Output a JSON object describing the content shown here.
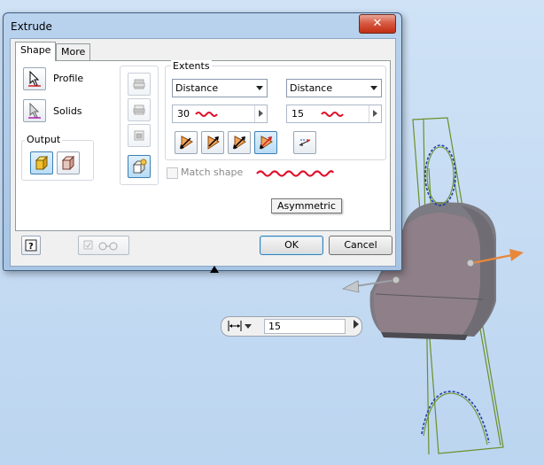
{
  "window": {
    "title": "Extrude",
    "close_glyph": "✕"
  },
  "tabs": [
    {
      "label": "Shape",
      "active": true
    },
    {
      "label": "More",
      "active": false
    }
  ],
  "shape": {
    "profile_label": "Profile",
    "solids_label": "Solids",
    "output_label": "Output"
  },
  "extents": {
    "label": "Extents",
    "direction1": {
      "type": "Distance",
      "value": "30"
    },
    "direction2": {
      "type": "Distance",
      "value": "15"
    }
  },
  "tooltip": "Asymmetric",
  "match_shape_label": "Match shape",
  "buttons": {
    "ok": "OK",
    "cancel": "Cancel"
  },
  "minibar": {
    "value": "15"
  },
  "colors": {
    "accent_orange": "#e8883a",
    "scribble_red": "#e0102a",
    "sketch_green": "#6b8f2a",
    "profile_blue": "#1f3ea8"
  },
  "icons": {
    "profile": "cursor-arrow-icon",
    "solids": "cursor-arrow-icon",
    "output_solid": "solid-box-icon",
    "output_surface": "surface-box-icon",
    "help": "help-icon",
    "preview": "glasses-icon"
  }
}
